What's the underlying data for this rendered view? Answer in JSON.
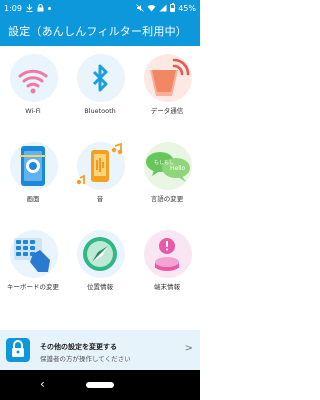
{
  "status_bar": {
    "time": "1:09",
    "battery": "45%",
    "icons": [
      "download-icon",
      "lock-icon",
      "dot-icon",
      "mute-icon",
      "wifi-icon",
      "signal-icon",
      "battery-icon"
    ]
  },
  "header": {
    "title": "設定（あんしんフィルター利用中）"
  },
  "tiles": [
    {
      "label": "Wi-Fi",
      "icon": "wifi-icon"
    },
    {
      "label": "Bluetooth",
      "icon": "bluetooth-icon"
    },
    {
      "label": "データ通信",
      "icon": "data-transmission-icon"
    },
    {
      "label": "画面",
      "icon": "screen-icon"
    },
    {
      "label": "音",
      "icon": "sound-icon"
    },
    {
      "label": "言語の変更",
      "icon": "language-icon"
    },
    {
      "label": "キーボードの変更",
      "icon": "keyboard-icon"
    },
    {
      "label": "位置情報",
      "icon": "location-icon"
    },
    {
      "label": "端末情報",
      "icon": "device-info-icon"
    }
  ],
  "bottom_banner": {
    "title": "その他の設定を変更する",
    "subtitle": "保護者の方が操作してください",
    "chevron": ">"
  },
  "nav": {
    "back": "‹"
  },
  "colors": {
    "primary": "#0e98dc",
    "tile_bg": "#e9f4fc"
  }
}
